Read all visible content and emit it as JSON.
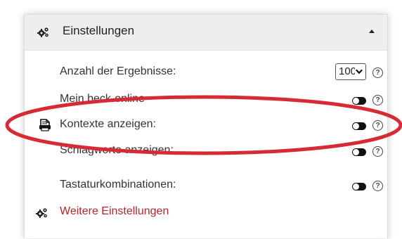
{
  "settings_panel": {
    "header": {
      "title": "Einstellungen",
      "icon": "gears-icon",
      "collapse_icon": "caret-up-icon"
    },
    "rows": [
      {
        "label": "Anzahl der Ergebnisse:",
        "control": "select",
        "value": "100"
      },
      {
        "label": "Mein beck-online",
        "control": "toggle",
        "state": "on"
      },
      {
        "label": "Kontexte anzeigen:",
        "control": "toggle",
        "state": "on",
        "icon": "document-print-icon"
      },
      {
        "label": "Schlagworte anzeigen:",
        "control": "toggle",
        "state": "on"
      },
      {
        "label": "Tastaturkombinationen:",
        "control": "toggle",
        "state": "on"
      }
    ],
    "more_link": {
      "label": "Weitere Einstellungen",
      "icon": "gears-icon",
      "color": "#b3262a"
    },
    "help_glyph": "?",
    "highlight_color": "#d62b35"
  }
}
